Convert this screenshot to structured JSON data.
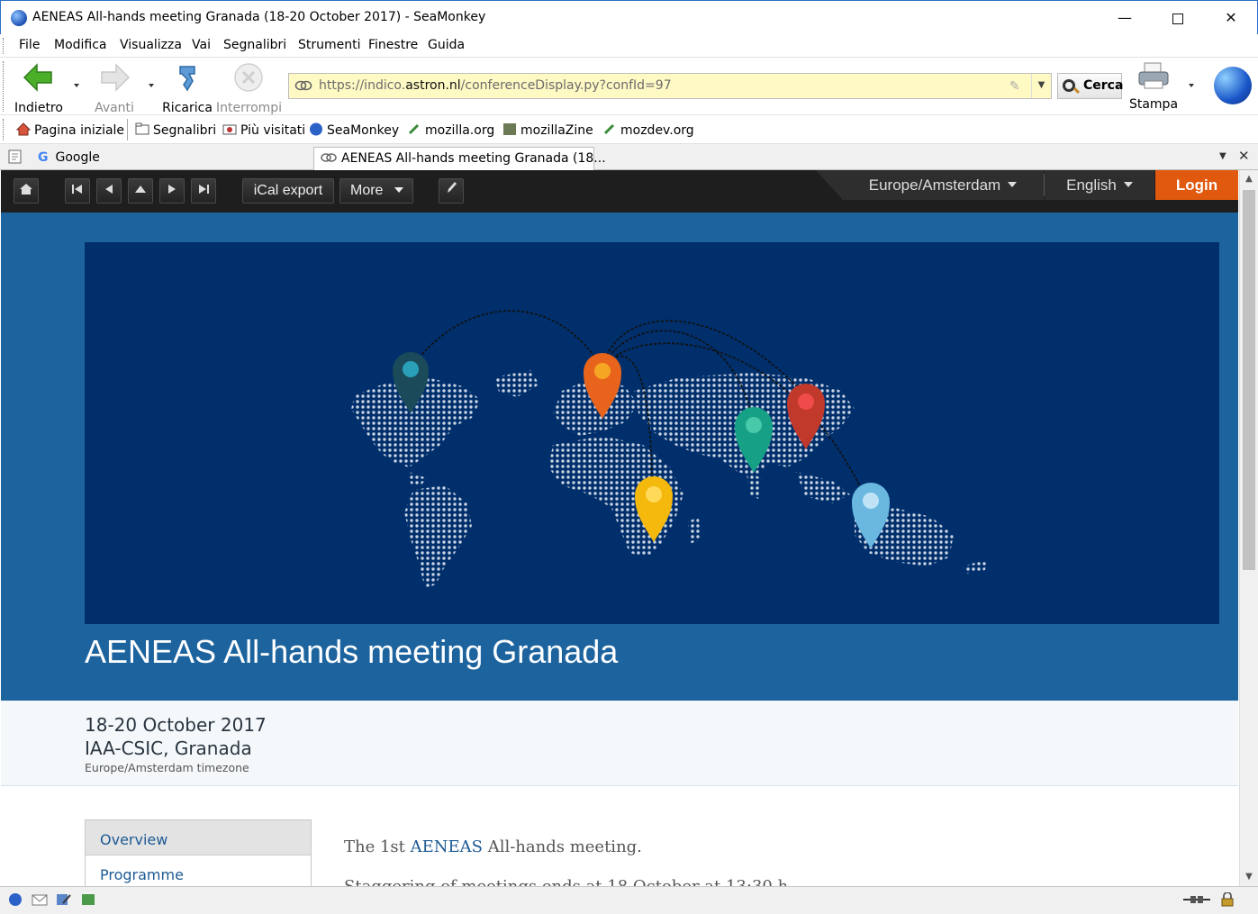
{
  "window": {
    "title": "AENEAS All-hands meeting Granada (18-20 October 2017) - SeaMonkey",
    "minimize": "—",
    "close": "✕"
  },
  "menu": [
    "File",
    "Modifica",
    "Visualizza",
    "Vai",
    "Segnalibri",
    "Strumenti",
    "Finestre",
    "Guida"
  ],
  "nav": {
    "back": "Indietro",
    "forward": "Avanti",
    "reload": "Ricarica",
    "stop": "Interrompi",
    "url_prefix": "https://indico.",
    "url_domain": "astron.nl",
    "url_path": "/conferenceDisplay.py?confId=97",
    "search": "Cerca",
    "print": "Stampa"
  },
  "bookmarks": [
    "Pagina iniziale",
    "Segnalibri",
    "Più visitati",
    "SeaMonkey",
    "mozilla.org",
    "mozillaZine",
    "mozdev.org"
  ],
  "tabs": [
    "Google",
    "AENEAS All-hands meeting Granada (18..."
  ],
  "indico": {
    "ical": "iCal export",
    "more": "More",
    "timezone": "Europe/Amsterdam",
    "language": "English",
    "login": "Login"
  },
  "event": {
    "title": "AENEAS All-hands meeting Granada",
    "dates": "18-20 October 2017",
    "venue": "IAA-CSIC, Granada",
    "timezone_note": "Europe/Amsterdam timezone"
  },
  "sidebar": [
    "Overview",
    "Programme"
  ],
  "content": {
    "intro_pre": "The 1st ",
    "intro_link": "AENEAS",
    "intro_post": " All-hands meeting.",
    "line2": "Staggering of meetings ends at 18 October at 13:30 h"
  },
  "colors": {
    "header_band": "#1d649f",
    "banner": "#002f6c",
    "login": "#e0590f",
    "pins": [
      "#1b4a5a",
      "#e8641c",
      "#f5b80c",
      "#16a085",
      "#c0392b",
      "#6ab7e0"
    ]
  }
}
